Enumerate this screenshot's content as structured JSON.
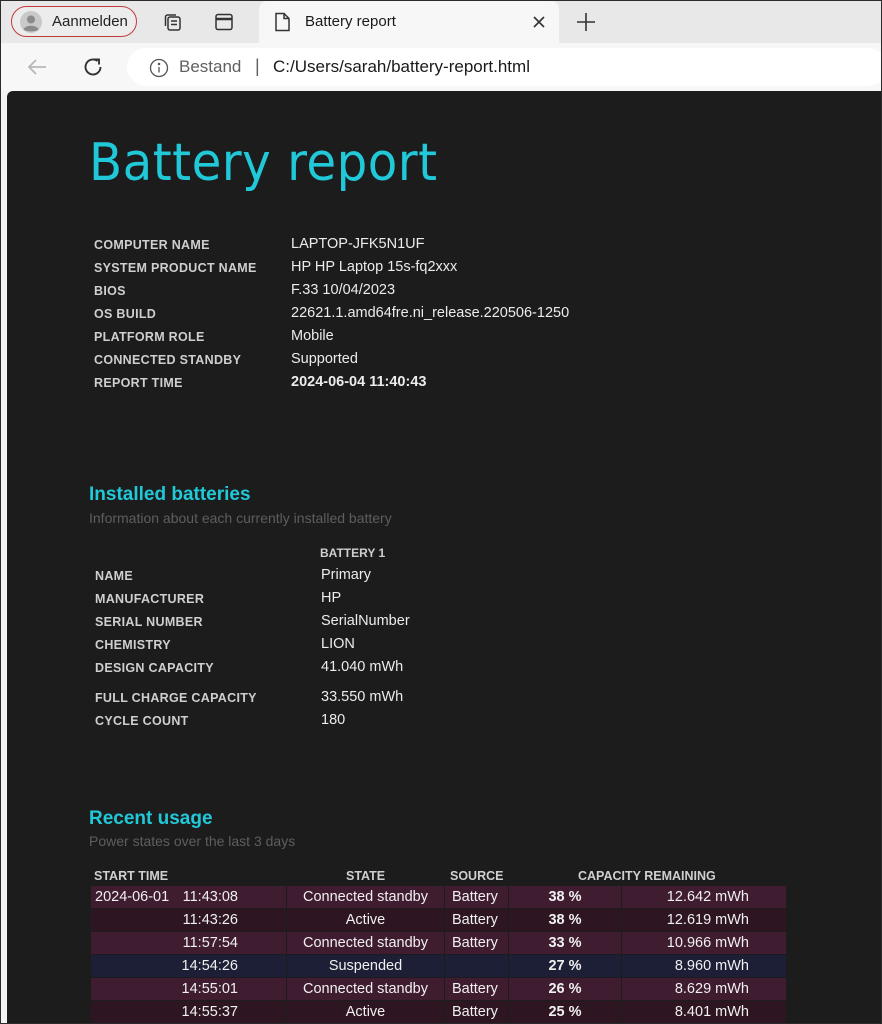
{
  "browser": {
    "profile_label": "Aanmelden",
    "tab_title": "Battery report",
    "address_scheme": "Bestand",
    "address_separator": "|",
    "address_url": "C:/Users/sarah/battery-report.html"
  },
  "report": {
    "title": "Battery report",
    "system_info": [
      {
        "label": "COMPUTER NAME",
        "value": "LAPTOP-JFK5N1UF"
      },
      {
        "label": "SYSTEM PRODUCT NAME",
        "value": "HP HP Laptop 15s-fq2xxx"
      },
      {
        "label": "BIOS",
        "value": "F.33 10/04/2023"
      },
      {
        "label": "OS BUILD",
        "value": "22621.1.amd64fre.ni_release.220506-1250"
      },
      {
        "label": "PLATFORM ROLE",
        "value": "Mobile"
      },
      {
        "label": "CONNECTED STANDBY",
        "value": "Supported"
      },
      {
        "label": "REPORT TIME",
        "value": "2024-06-04  11:40:43"
      }
    ]
  },
  "installed_batteries": {
    "heading": "Installed batteries",
    "subtitle": "Information about each currently installed battery",
    "column_header": "BATTERY 1",
    "rows": [
      {
        "label": "NAME",
        "value": "Primary"
      },
      {
        "label": "MANUFACTURER",
        "value": "HP"
      },
      {
        "label": "SERIAL NUMBER",
        "value": "SerialNumber"
      },
      {
        "label": "CHEMISTRY",
        "value": "LION"
      },
      {
        "label": "DESIGN CAPACITY",
        "value": "41.040 mWh"
      },
      {
        "label": "FULL CHARGE CAPACITY",
        "value": "33.550 mWh"
      },
      {
        "label": "CYCLE COUNT",
        "value": "180"
      }
    ]
  },
  "recent_usage": {
    "heading": "Recent usage",
    "subtitle": "Power states over the last 3 days",
    "headers": {
      "start_time": "START TIME",
      "state": "STATE",
      "source": "SOURCE",
      "capacity": "CAPACITY REMAINING"
    },
    "rows": [
      {
        "date": "2024-06-01",
        "time": "11:43:08",
        "state": "Connected standby",
        "source": "Battery",
        "percent": "38 %",
        "mwh": "12.642 mWh",
        "color": "#3f1c30"
      },
      {
        "date": "",
        "time": "11:43:26",
        "state": "Active",
        "source": "Battery",
        "percent": "38 %",
        "mwh": "12.619 mWh",
        "color": "#2e1522"
      },
      {
        "date": "",
        "time": "11:57:54",
        "state": "Connected standby",
        "source": "Battery",
        "percent": "33 %",
        "mwh": "10.966 mWh",
        "color": "#3f1c30"
      },
      {
        "date": "",
        "time": "14:54:26",
        "state": "Suspended",
        "source": "",
        "percent": "27 %",
        "mwh": "8.960 mWh",
        "color": "#1d1f36"
      },
      {
        "date": "",
        "time": "14:55:01",
        "state": "Connected standby",
        "source": "Battery",
        "percent": "26 %",
        "mwh": "8.629 mWh",
        "color": "#3f1c30"
      },
      {
        "date": "",
        "time": "14:55:37",
        "state": "Active",
        "source": "Battery",
        "percent": "25 %",
        "mwh": "8.401 mWh",
        "color": "#2e1522"
      }
    ]
  }
}
